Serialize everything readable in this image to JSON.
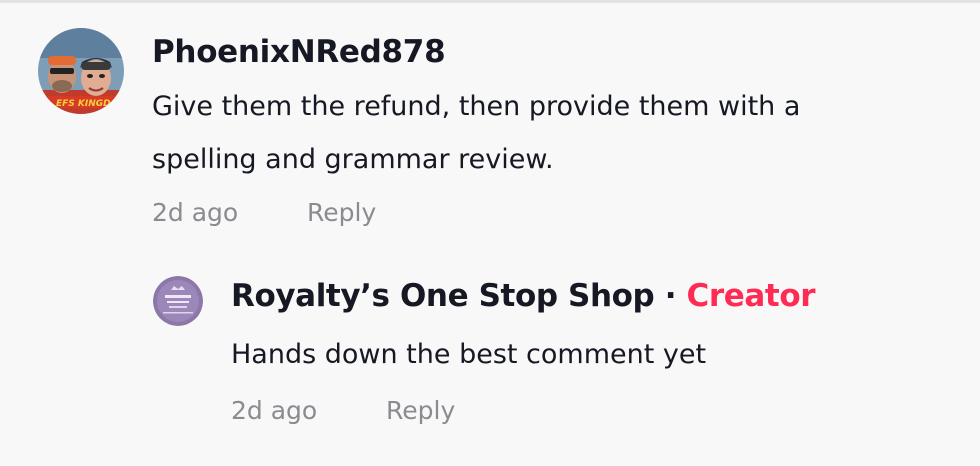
{
  "comment": {
    "username": "PhoenixNRed878",
    "text": "Give them the refund, then provide them with a spelling and grammar review.",
    "time": "2d ago",
    "reply_label": "Reply"
  },
  "reply": {
    "username": "Royalty’s One Stop Shop",
    "separator": "·",
    "badge": "Creator",
    "text": "Hands down the best comment yet",
    "time": "2d ago",
    "reply_label": "Reply"
  },
  "colors": {
    "background": "#f8f8f8",
    "text": "#161823",
    "meta": "#8a8b91",
    "creator_badge": "#fe2c55"
  }
}
